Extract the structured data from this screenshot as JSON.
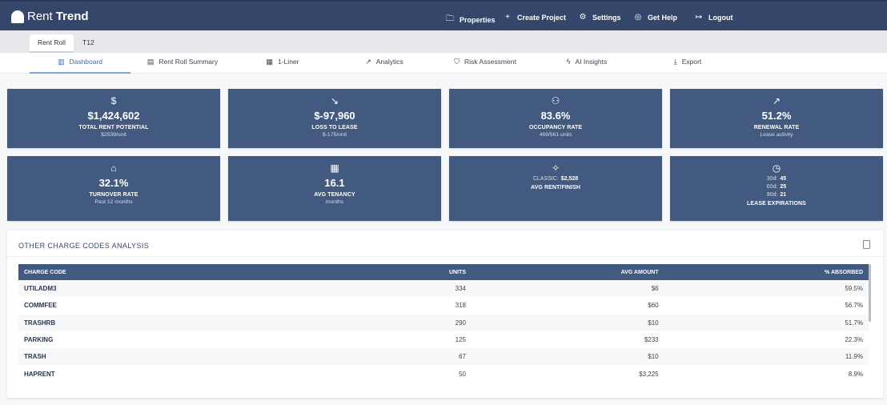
{
  "app": {
    "brand_light": "Rent",
    "brand_bold": "Trend"
  },
  "nav": [
    {
      "icon": "folder-icon",
      "label": "Properties"
    },
    {
      "icon": "plus-icon",
      "label": "Create Project"
    },
    {
      "icon": "gear-icon",
      "label": "Settings"
    },
    {
      "icon": "help-icon",
      "label": "Get Help"
    },
    {
      "icon": "logout-icon",
      "label": "Logout"
    }
  ],
  "subtabs": [
    "Rent Roll",
    "T12"
  ],
  "tabs": [
    "Dashboard",
    "Rent Roll Summary",
    "1-Liner",
    "Analytics",
    "Risk Assessment",
    "AI Insights",
    "Export"
  ],
  "cards": [
    {
      "icon": "dollar-icon",
      "value": "$1,424,602",
      "label": "TOTAL RENT POTENTIAL",
      "sub": "$2539/unit"
    },
    {
      "icon": "trending-down-icon",
      "value": "$-97,960",
      "label": "LOSS TO LEASE",
      "sub": "$-175/unit"
    },
    {
      "icon": "users-icon",
      "value": "83.6%",
      "label": "OCCUPANCY RATE",
      "sub": "469/561 units"
    },
    {
      "icon": "trending-up-icon",
      "value": "51.2%",
      "label": "RENEWAL RATE",
      "sub": "Lease activity"
    },
    {
      "icon": "home-icon",
      "value": "32.1%",
      "label": "TURNOVER RATE",
      "sub": "Past 12 months"
    },
    {
      "icon": "calendar-icon",
      "value": "16.1",
      "label": "AVG TENANCY",
      "sub": "months"
    },
    {
      "icon": "sparkles-icon",
      "kv": [
        {
          "k": "CLASSIC:",
          "v": "$2,528"
        }
      ],
      "label": "AVG RENT/FINISH"
    },
    {
      "icon": "clock-icon",
      "kv": [
        {
          "k": "30d:",
          "v": "45"
        },
        {
          "k": "60d:",
          "v": "25"
        },
        {
          "k": "90d:",
          "v": "21"
        }
      ],
      "label": "LEASE EXPIRATIONS"
    }
  ],
  "panel": {
    "title": "OTHER CHARGE CODES ANALYSIS",
    "columns": [
      "CHARGE CODE",
      "UNITS",
      "AVG AMOUNT",
      "% ABSORBED"
    ],
    "rows": [
      [
        "UTILADM3",
        "334",
        "$6",
        "59.5%"
      ],
      [
        "COMMFEE",
        "318",
        "$60",
        "56.7%"
      ],
      [
        "TRASHRB",
        "290",
        "$10",
        "51.7%"
      ],
      [
        "PARKING",
        "125",
        "$233",
        "22.3%"
      ],
      [
        "TRASH",
        "67",
        "$10",
        "11.9%"
      ],
      [
        "HAPRENT",
        "50",
        "$3,225",
        "8.9%"
      ]
    ]
  },
  "colors": {
    "header": "#34476a",
    "card": "#435a80",
    "accent": "#3d6bb3"
  }
}
